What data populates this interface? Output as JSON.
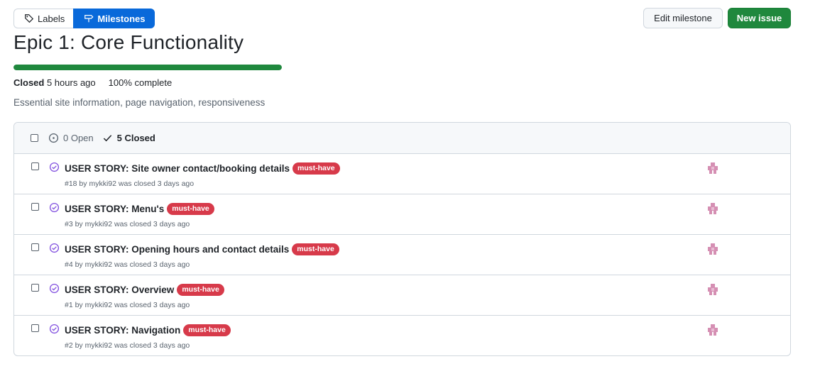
{
  "tabs": {
    "labels": "Labels",
    "milestones": "Milestones"
  },
  "buttons": {
    "edit": "Edit milestone",
    "new_issue": "New issue"
  },
  "milestone": {
    "title": "Epic 1: Core Functionality",
    "progress_percent": 100,
    "closed_label": "Closed",
    "closed_time": "5 hours ago",
    "complete": "100% complete",
    "description": "Essential site information, page navigation, responsiveness"
  },
  "filters": {
    "open": "0 Open",
    "closed": "5 Closed"
  },
  "colors": {
    "accent_blue": "#0969da",
    "green": "#1f883d",
    "label_red": "#d73a4a",
    "closed_purple": "#8250df"
  },
  "issues": [
    {
      "title": "USER STORY: Site owner contact/booking details",
      "label": "must-have",
      "meta": "#18 by mykki92 was closed 3 days ago"
    },
    {
      "title": "USER STORY: Menu's",
      "label": "must-have",
      "meta": "#3 by mykki92 was closed 3 days ago"
    },
    {
      "title": "USER STORY: Opening hours and contact details",
      "label": "must-have",
      "meta": "#4 by mykki92 was closed 3 days ago"
    },
    {
      "title": "USER STORY: Overview",
      "label": "must-have",
      "meta": "#1 by mykki92 was closed 3 days ago"
    },
    {
      "title": "USER STORY: Navigation",
      "label": "must-have",
      "meta": "#2 by mykki92 was closed 3 days ago"
    }
  ]
}
